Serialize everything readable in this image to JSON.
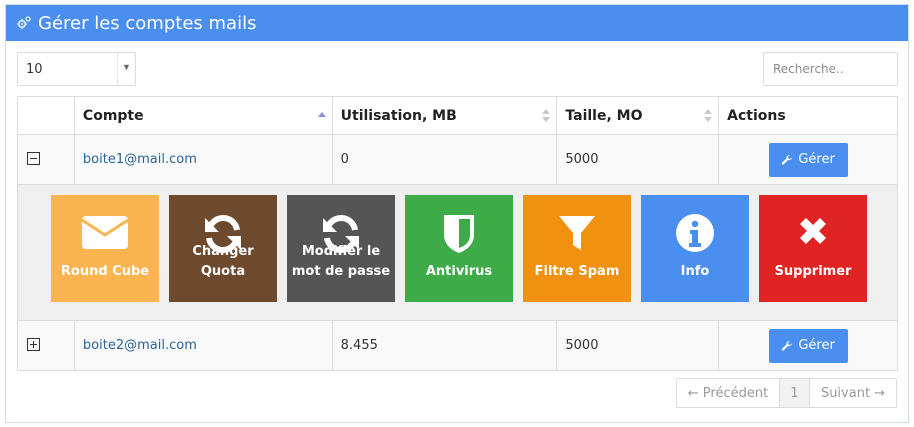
{
  "header": {
    "title": "Gérer les comptes mails",
    "icon": "gears-icon",
    "color": "#4a8ef0"
  },
  "page_length": {
    "value": "10"
  },
  "search": {
    "placeholder": "Recherche.."
  },
  "table": {
    "columns": [
      "",
      "Compte",
      "Utilisation, MB",
      "Taille, MO",
      "Actions"
    ],
    "rows": [
      {
        "account": "boite1@mail.com",
        "usage": "0",
        "size": "5000",
        "action": "Gérer",
        "expanded": true
      },
      {
        "account": "boite2@mail.com",
        "usage": "8.455",
        "size": "5000",
        "action": "Gérer",
        "expanded": false
      }
    ]
  },
  "tiles": [
    {
      "label": "Round Cube",
      "icon": "envelope-icon",
      "color": "#fbb450"
    },
    {
      "label": "Changer Quota",
      "icon": "refresh-icon",
      "color": "#6d4a2e"
    },
    {
      "label": "Modifier le mot de passe",
      "icon": "refresh-icon",
      "color": "#555555"
    },
    {
      "label": "Antivirus",
      "icon": "shield-icon",
      "color": "#3cab48"
    },
    {
      "label": "Filtre Spam",
      "icon": "filter-icon",
      "color": "#f0910f"
    },
    {
      "label": "Info",
      "icon": "info-icon",
      "color": "#4a8ef0"
    },
    {
      "label": "Supprimer",
      "icon": "close-icon",
      "color": "#e02424"
    }
  ],
  "pagination": {
    "prev": "← Précédent",
    "page": "1",
    "next": "Suivant →"
  }
}
